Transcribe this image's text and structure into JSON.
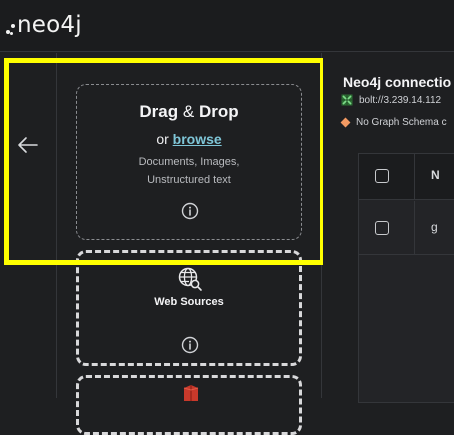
{
  "header": {
    "logo_text": "neo4j"
  },
  "sources_panel": {
    "drop_card": {
      "title_drag": "Drag",
      "title_amp": "&",
      "title_drop": "Drop",
      "or_text": "or",
      "browse_label": "browse",
      "description_line1": "Documents, Images,",
      "description_line2": "Unstructured text"
    },
    "web_card": {
      "title": "Web Sources"
    }
  },
  "main": {
    "connection_title": "Neo4j connectio",
    "connection_url": "bolt://3.239.14.112",
    "schema_status": "No Graph Schema c",
    "table": {
      "header_col": "N",
      "row_cell": "g"
    }
  },
  "colors": {
    "highlight": "#ffff00",
    "browse_link": "#7fc6d8",
    "schema_dot": "#f39a62",
    "db_icon": "#3fa34d",
    "s3_icon": "#c8392b"
  }
}
